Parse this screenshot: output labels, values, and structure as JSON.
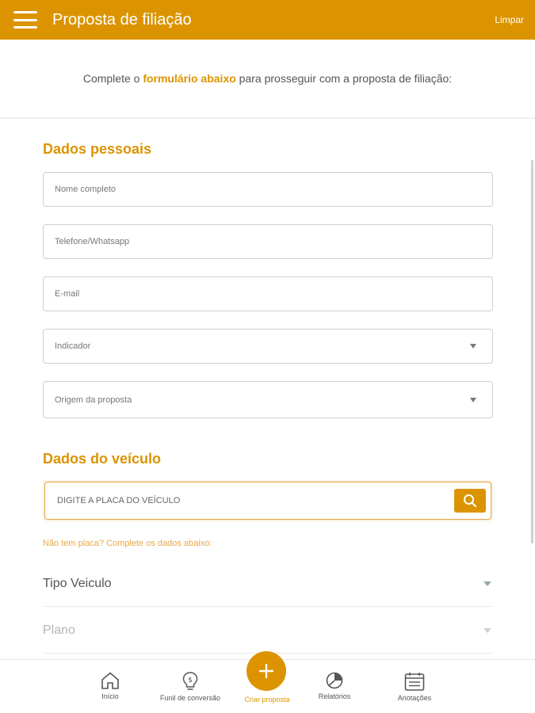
{
  "appbar": {
    "title": "Proposta de filiação",
    "clear_label": "Limpar",
    "menu_icon": "hamburger-menu-icon"
  },
  "intro": {
    "prefix": "Complete o ",
    "highlight": "formulário abaixo",
    "suffix": " para prosseguir com a proposta de filiação:"
  },
  "personal": {
    "title": "Dados pessoais",
    "name_placeholder": "Nome completo",
    "phone_placeholder": "Telefone/Whatsapp",
    "email_placeholder": "E-mail",
    "referrer_placeholder": "Indicador",
    "origin_placeholder": "Origem da proposta"
  },
  "vehicle": {
    "title": "Dados do veículo",
    "plate_placeholder": "DIGITE A PLACA DO VEÍCULO",
    "no_plate_hint": "Não tem placa? Complete os dados abaixo:",
    "type_label": "Tipo Veiculo",
    "plan_label": "Plano"
  },
  "nav": {
    "items": [
      {
        "label": "Início",
        "icon": "home-icon"
      },
      {
        "label": "Funil de conversão",
        "icon": "lightbulb-dollar-icon"
      },
      {
        "label": "Criar proposta",
        "icon": "plus-icon"
      },
      {
        "label": "Relatórios",
        "icon": "pie-chart-icon"
      },
      {
        "label": "Anotações",
        "icon": "notes-icon"
      }
    ]
  },
  "colors": {
    "accent": "#db9400",
    "hint": "#e8a84a"
  }
}
